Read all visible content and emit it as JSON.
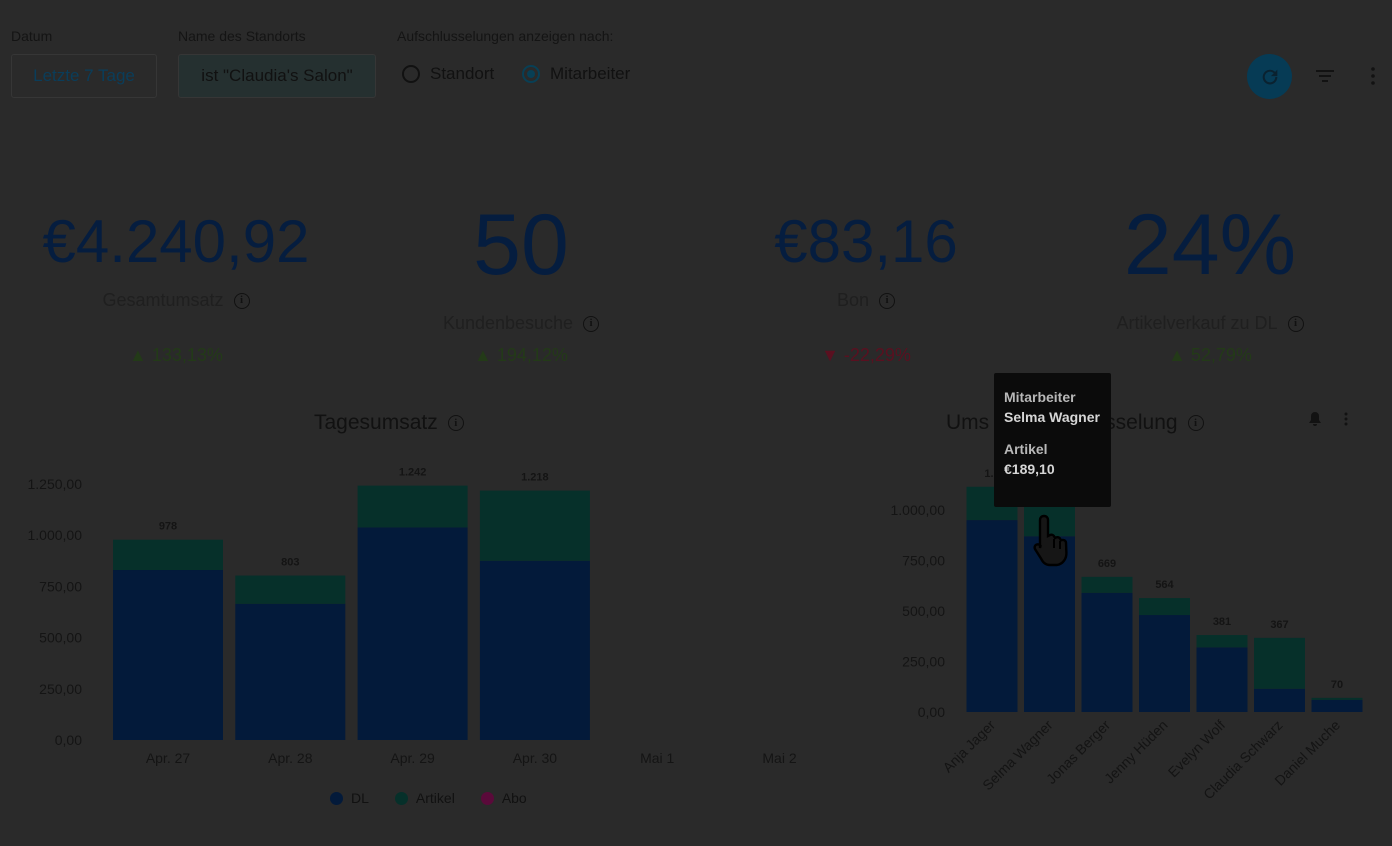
{
  "filters": {
    "date_label": "Datum",
    "date_value": "Letzte 7 Tage",
    "location_label": "Name des Standorts",
    "location_value": "ist \"Claudia's Salon\"",
    "breakdown_label": "Aufschlusselungen anzeigen nach:",
    "option_location": "Standort",
    "option_employee": "Mitarbeiter",
    "selected_option": "Mitarbeiter"
  },
  "icons": {
    "refresh": "refresh-icon",
    "filter": "filter-icon",
    "more": "more-vertical-icon",
    "alert": "bell-icon"
  },
  "kpis": [
    {
      "value": "€4.240,92",
      "label": "Gesamtumsatz",
      "delta": "▲ 133,13%",
      "trend": "up"
    },
    {
      "value": "50",
      "label": "Kundenbesuche",
      "delta": "▲ 194,12%",
      "trend": "up"
    },
    {
      "value": "€83,16",
      "label": "Bon",
      "delta": "▼ -22,29%",
      "trend": "down"
    },
    {
      "value": "24%",
      "label": "Artikelverkauf zu DL",
      "delta": "▲ 52,79%",
      "trend": "up"
    }
  ],
  "colors": {
    "dl": "#031a3a",
    "artikel": "#06302a",
    "abo": "#5a0a3a",
    "accent": "#063b55",
    "up": "#2e4a20",
    "down": "#6a1424"
  },
  "chart_data": [
    {
      "type": "bar",
      "title": "Tagesumsatz",
      "categories": [
        "Apr. 27",
        "Apr. 28",
        "Apr. 29",
        "Apr. 30",
        "Mai 1",
        "Mai 2"
      ],
      "series": [
        {
          "name": "DL",
          "values": [
            830,
            665,
            1038,
            875,
            0,
            0
          ]
        },
        {
          "name": "Artikel",
          "values": [
            148,
            138,
            204,
            343,
            0,
            0
          ]
        },
        {
          "name": "Abo",
          "values": [
            0,
            0,
            0,
            0,
            0,
            0
          ]
        }
      ],
      "totals": [
        "978",
        "803",
        "1.242",
        "1.218",
        "",
        ""
      ],
      "yticks": [
        "0,00",
        "250,00",
        "500,00",
        "750,00",
        "1.000,00",
        "1.250,00"
      ],
      "ylim": [
        0,
        1250
      ],
      "legend": [
        "DL",
        "Artikel",
        "Abo"
      ]
    },
    {
      "type": "bar",
      "title": "Umsatzaufschlüsselung",
      "title_visible_left": "Ums",
      "title_visible_right": "sselung",
      "categories": [
        "Anja Jäger",
        "Selma Wagner",
        "Jonas Berger",
        "Jenny Hüden",
        "Evelyn Wolf",
        "Claudia Schwarz",
        "Daniel Muche"
      ],
      "series": [
        {
          "name": "DL",
          "values": [
            950,
            870,
            590,
            480,
            320,
            115,
            60
          ]
        },
        {
          "name": "Artikel",
          "values": [
            165,
            189.1,
            79,
            84,
            61,
            252,
            10
          ]
        }
      ],
      "totals": [
        "1.1",
        "",
        "669",
        "564",
        "381",
        "367",
        "70"
      ],
      "yticks": [
        "0,00",
        "250,00",
        "500,00",
        "750,00",
        "1.000,00"
      ],
      "ylim": [
        0,
        1000
      ]
    }
  ],
  "tooltip": {
    "title_label": "Mitarbeiter",
    "title_value": "Selma Wagner",
    "series_label": "Artikel",
    "series_value": "€189,10"
  },
  "axis_labels_right": [
    "Anja Jager",
    "Selma Wagner",
    "Jonas Berger",
    "Jenny Hüden",
    "Evelyn Wolf",
    "Claudia Schwarz",
    "Daniel Muche"
  ]
}
